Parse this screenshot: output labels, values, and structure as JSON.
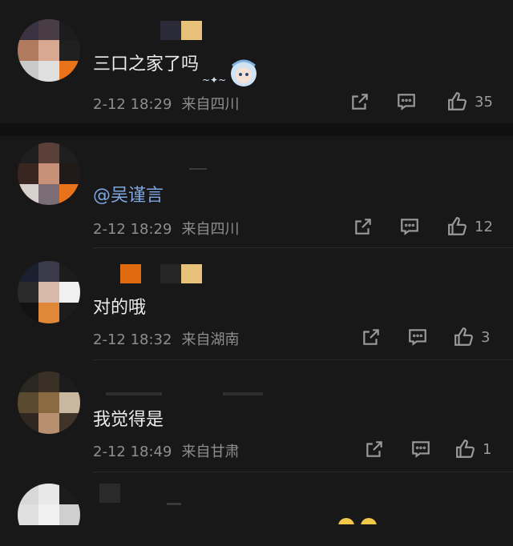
{
  "comments": [
    {
      "text": "三口之家了吗",
      "date": "2-12 18:29",
      "location": "来自四川",
      "likes": "35"
    },
    {
      "mention": "@吴谨言",
      "date": "2-12 18:29",
      "location": "来自四川",
      "likes": "12"
    },
    {
      "text": "对的哦",
      "date": "2-12 18:32",
      "location": "来自湖南",
      "likes": "3"
    },
    {
      "text": "我觉得是",
      "date": "2-12 18:49",
      "location": "来自甘肃",
      "likes": "1"
    }
  ],
  "icons": {
    "share": "share-icon",
    "reply": "comment-icon",
    "like": "thumbs-up-icon"
  },
  "colors": {
    "background": "#181818",
    "mention": "#7ea6e0",
    "meta": "#8e8e8e"
  }
}
